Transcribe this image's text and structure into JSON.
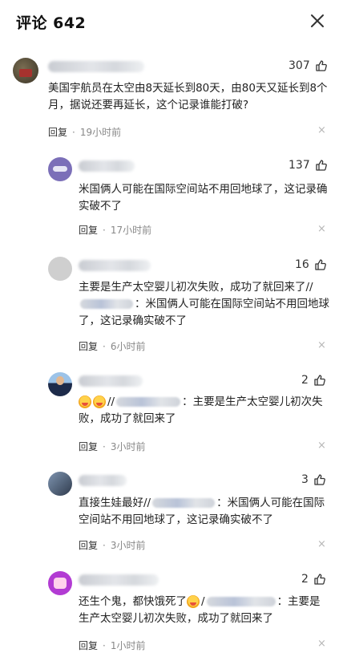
{
  "header": {
    "title": "评论 642"
  },
  "icons": {
    "close": "close-icon",
    "like": "thumbs-up-icon",
    "dismiss": "dismiss-x-icon"
  },
  "colors": {
    "text": "#222222",
    "meta": "#888888",
    "dismiss": "#b6b6b6"
  },
  "comments": [
    {
      "likes": "307",
      "text": "美国宇航员在太空由8天延长到80天，由80天又延长到8个月，据说还要再延长，这个记录谁能打破?",
      "reply": "回复",
      "sep": "·",
      "time": "19小时前",
      "x": "×"
    },
    {
      "likes": "137",
      "text": "米国俩人可能在国际空间站不用回地球了，这记录确实破不了",
      "reply": "回复",
      "sep": "·",
      "time": "17小时前",
      "x": "×"
    },
    {
      "likes": "16",
      "text_a": "主要是生产太空婴儿初次失败，成功了就回来了//",
      "text_b": "：米国俩人可能在国际空间站不用回地球了，这记录确实破不了",
      "reply": "回复",
      "sep": "·",
      "time": "6小时前",
      "x": "×"
    },
    {
      "likes": "2",
      "text_a": "//",
      "text_b": "：主要是生产太空婴儿初次失败，成功了就回来了",
      "reply": "回复",
      "sep": "·",
      "time": "3小时前",
      "x": "×"
    },
    {
      "likes": "3",
      "text_a": "直接生娃最好//",
      "text_b": "：米国俩人可能在国际空间站不用回地球了，这记录确实破不了",
      "reply": "回复",
      "sep": "·",
      "time": "3小时前",
      "x": "×"
    },
    {
      "likes": "2",
      "text_a": "还生个鬼，都快饿死了",
      "text_b": "/",
      "text_c": "：主要是生产太空婴儿初次失败，成功了就回来了",
      "reply": "回复",
      "sep": "·",
      "time": "1小时前",
      "x": "×"
    }
  ]
}
